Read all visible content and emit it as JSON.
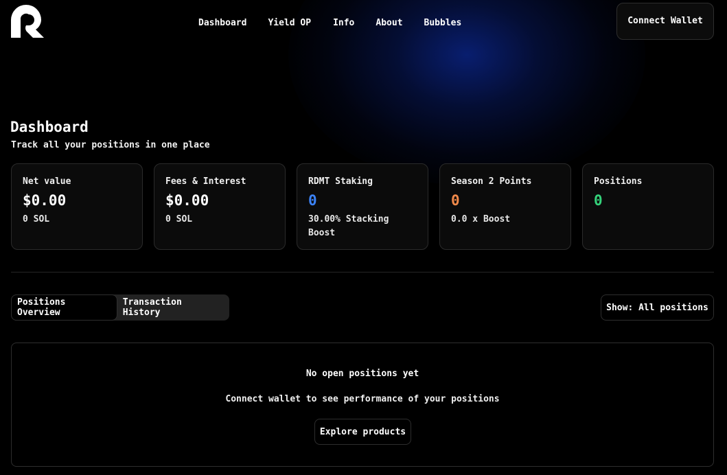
{
  "header": {
    "logo": "rounded-r-logo",
    "nav": [
      {
        "label": "Dashboard"
      },
      {
        "label": "Yield OP"
      },
      {
        "label": "Info"
      },
      {
        "label": "About"
      },
      {
        "label": "Bubbles"
      }
    ],
    "connect_label": "Connect Wallet"
  },
  "page": {
    "title": "Dashboard",
    "subtitle": "Track all your positions in one place"
  },
  "cards": [
    {
      "label": "Net value",
      "value": "$0.00",
      "sub": "0 SOL",
      "value_color": "#ffffff"
    },
    {
      "label": "Fees & Interest",
      "value": "$0.00",
      "sub": "0 SOL",
      "value_color": "#ffffff"
    },
    {
      "label": "RDMT Staking",
      "value": "0",
      "sub": "30.00% Stacking Boost",
      "value_color": "#3b82f6"
    },
    {
      "label": "Season 2 Points",
      "value": "0",
      "sub": "0.0 x Boost",
      "value_color": "#f0894a"
    },
    {
      "label": "Positions",
      "value": "0",
      "sub": "",
      "value_color": "#34d27a"
    }
  ],
  "tabs": [
    {
      "label": "Positions Overview",
      "active": true
    },
    {
      "label": "Transaction History",
      "active": false
    }
  ],
  "filter_label": "Show: All positions",
  "empty_state": {
    "title": "No open positions yet",
    "message": "Connect wallet to see performance of your positions",
    "button_label": "Explore products"
  }
}
